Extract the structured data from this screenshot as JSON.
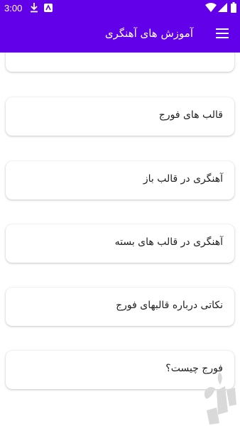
{
  "status_bar": {
    "time": "3:00",
    "icons_left": [
      "download-icon",
      "app-notification-icon"
    ],
    "icons_right": [
      "wifi-icon",
      "cellular-signal-icon",
      "battery-icon"
    ]
  },
  "toolbar": {
    "title": "آموزش های آهنگری",
    "menu_icon": "hamburger-menu-icon"
  },
  "list": {
    "items": [
      {
        "label": ""
      },
      {
        "label": "قالب های فورج"
      },
      {
        "label": "آهنگری در قالب باز"
      },
      {
        "label": "آهنگری در قالب های بسته"
      },
      {
        "label": "نکاتی درباره قالبهای فورج"
      },
      {
        "label": "فورج چیست؟"
      }
    ]
  },
  "watermark": {
    "icon": "bazaar-logo-icon"
  },
  "colors": {
    "primary": "#6200ea",
    "card_background": "#ffffff",
    "text": "#222222",
    "watermark": "#d9d9d9"
  }
}
